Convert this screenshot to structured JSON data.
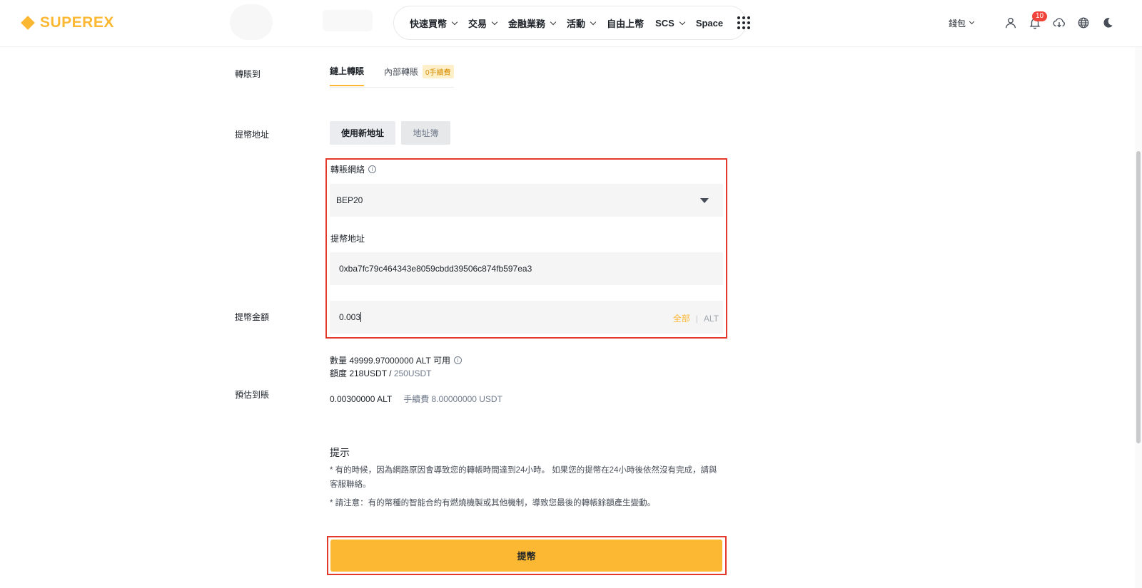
{
  "brand": {
    "name": "SUPEREX",
    "color": "#fcb833"
  },
  "nav": {
    "items": [
      {
        "label": "快速買幣",
        "has_dropdown": true
      },
      {
        "label": "交易",
        "has_dropdown": true
      },
      {
        "label": "金融業務",
        "has_dropdown": true
      },
      {
        "label": "活動",
        "has_dropdown": true
      },
      {
        "label": "自由上幣",
        "has_dropdown": false
      },
      {
        "label": "SCS",
        "has_dropdown": true
      },
      {
        "label": "Space",
        "has_dropdown": false
      }
    ],
    "more_icon": "grid-dots-icon"
  },
  "tools": {
    "wallet_label": "錢包",
    "notification_count": "10",
    "icons": [
      "user-icon",
      "bell-icon",
      "download-icon",
      "globe-icon",
      "moon-icon"
    ]
  },
  "form": {
    "transfer_to": {
      "label": "轉賬到",
      "tab_onchain": "鏈上轉賬",
      "tab_internal": "內部轉賬",
      "internal_tag": "0手續費"
    },
    "address": {
      "label": "提幣地址",
      "btn_new": "使用新地址",
      "btn_book": "地址簿"
    },
    "network": {
      "label": "轉賬網絡",
      "value": "BEP20"
    },
    "withdraw_address": {
      "label": "提幣地址",
      "value": "0xba7fc79c464343e8059cbdd39506c874fb597ea3"
    },
    "amount": {
      "label": "提幣金額",
      "value": "0.003",
      "all_label": "全部",
      "unit": "ALT"
    },
    "balance": {
      "quantity_text": "數量 49999.97000000 ALT 可用",
      "limit_prefix": "額度 218USDT /",
      "limit_total": "250USDT"
    },
    "estimate": {
      "label": "預估到賬",
      "value": "0.00300000 ALT",
      "fee": "手續費 8.00000000 USDT"
    }
  },
  "tips": {
    "title": "提示",
    "items": [
      "* 有的時候，因為網路原因會導致您的轉帳時間達到24小時。 如果您的提幣在24小時後依然沒有完成，請與客服聯絡。",
      "* 請注意：有的幣種的智能合約有燃燒機製或其他機制，導致您最後的轉帳餘額產生變動。"
    ]
  },
  "submit_label": "提幣",
  "colors": {
    "accent": "#fcb833",
    "highlight_border": "#e3392d",
    "badge": "#f0453a"
  }
}
